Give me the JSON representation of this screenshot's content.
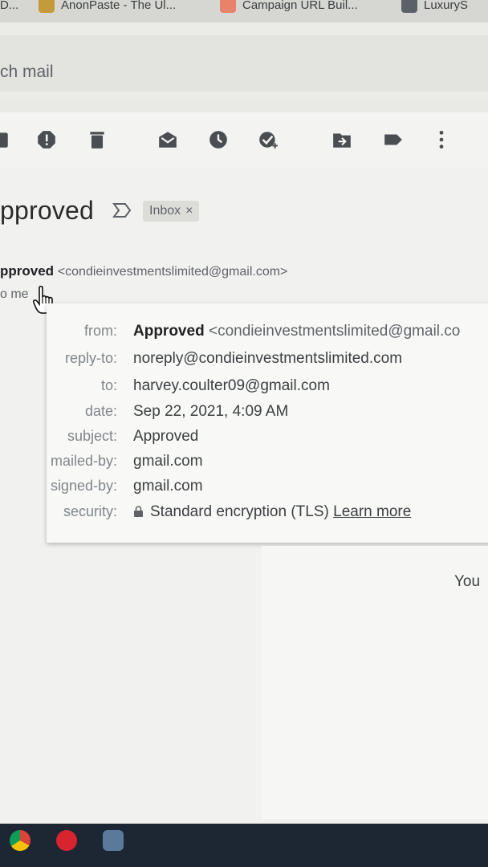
{
  "bookmarks": [
    {
      "label": "D...",
      "icon": "page-icon"
    },
    {
      "label": "AnonPaste - The Ul...",
      "icon": "anonpaste-icon"
    },
    {
      "label": "Campaign URL Buil...",
      "icon": "campaign-icon"
    },
    {
      "label": "LuxuryS",
      "icon": "luxury-icon"
    }
  ],
  "search": {
    "placeholder": "ch mail"
  },
  "toolbar": {
    "icons": [
      "archive-icon",
      "report-spam-icon",
      "delete-icon",
      "mark-unread-icon",
      "snooze-icon",
      "add-task-icon",
      "move-to-icon",
      "labels-icon",
      "more-icon"
    ]
  },
  "email": {
    "subject": "pproved",
    "label": "Inbox",
    "label_close": "×",
    "sender_name": "pproved",
    "sender_email": "<condieinvestmentslimited@gmail.com>",
    "to_me": "o me",
    "body_snippet": "You"
  },
  "details": {
    "rows": [
      {
        "label": "from:",
        "name": "Approved",
        "value": "<condieinvestmentslimited@gmail.co"
      },
      {
        "label": "reply-to:",
        "value": "noreply@condieinvestmentslimited.com"
      },
      {
        "label": "to:",
        "value": "harvey.coulter09@gmail.com"
      },
      {
        "label": "date:",
        "value": "Sep 22, 2021, 4:09 AM"
      },
      {
        "label": "subject:",
        "value": "Approved"
      },
      {
        "label": "mailed-by:",
        "value": "gmail.com"
      },
      {
        "label": "signed-by:",
        "value": "gmail.com"
      },
      {
        "label": "security:",
        "value": "Standard encryption (TLS)",
        "link": "Learn more"
      }
    ]
  },
  "taskbar": {
    "icons": [
      "chrome-icon",
      "opera-icon",
      "app-icon"
    ]
  },
  "colors": {
    "background": "#e9e9e6",
    "popup": "#f8f8f6",
    "taskbar": "#1d2733"
  }
}
